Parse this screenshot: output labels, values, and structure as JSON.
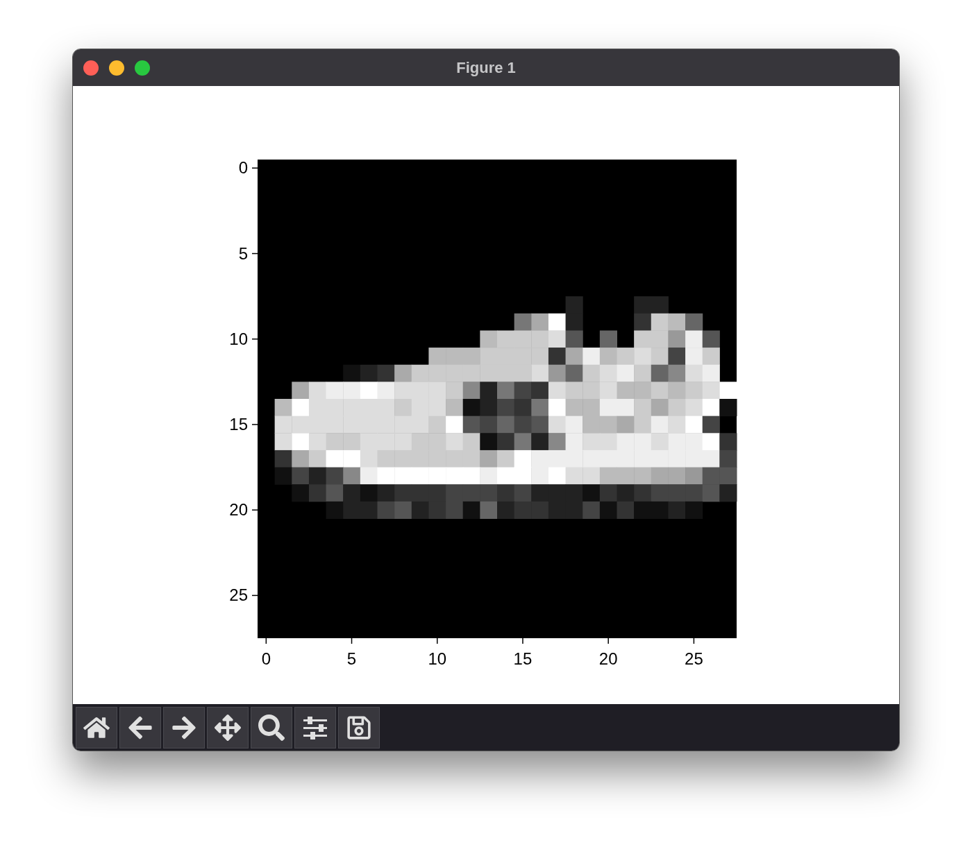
{
  "window": {
    "title": "Figure 1"
  },
  "axes": {
    "xticks": [
      "0",
      "5",
      "10",
      "15",
      "20",
      "25"
    ],
    "yticks": [
      "0",
      "5",
      "10",
      "15",
      "20",
      "25"
    ]
  }
}
